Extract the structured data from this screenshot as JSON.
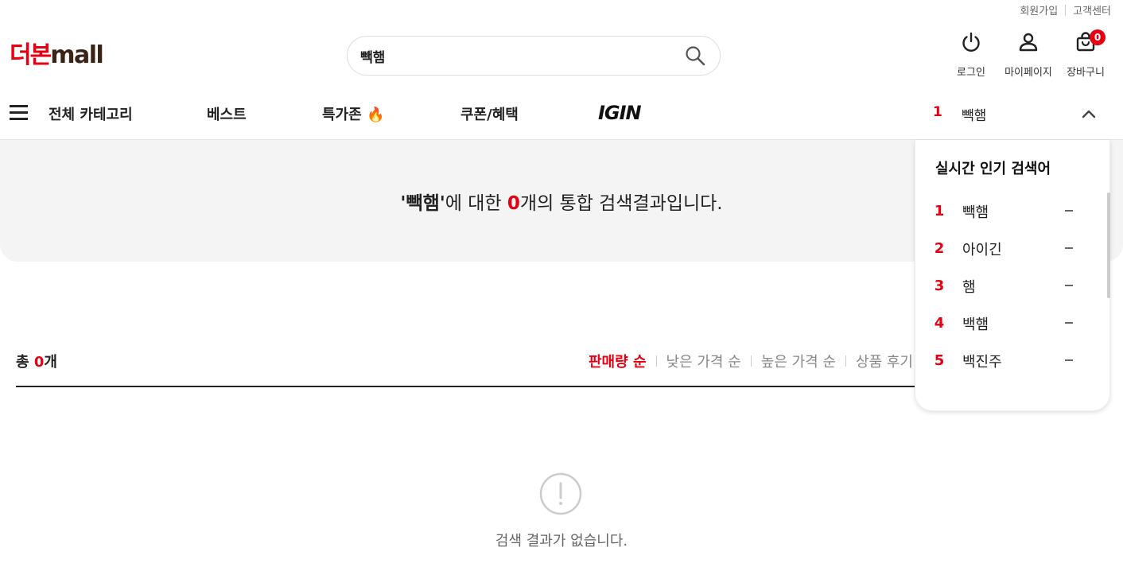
{
  "util": {
    "signup": "회원가입",
    "support": "고객센터"
  },
  "logo": {
    "ko": "더본",
    "en": "mall"
  },
  "search": {
    "value": "빽햄",
    "icon": "search-icon"
  },
  "header_icons": {
    "login": "로그인",
    "mypage": "마이페이지",
    "cart": "장바구니",
    "cart_count": "0"
  },
  "gnb": {
    "all_category": "전체 카테고리",
    "best": "베스트",
    "special": "특가존 🔥",
    "coupon": "쿠폰/혜택",
    "brand": "IGIN",
    "rolling_rank": "1",
    "rolling_word": "빽햄"
  },
  "result": {
    "q_open": "'",
    "keyword": "빽햄",
    "q_close": "'",
    "mid": "에 대한 ",
    "count": "0",
    "tail": "개의 통합 검색결과입니다."
  },
  "list_header": {
    "total_prefix": "총 ",
    "total_count": "0",
    "total_suffix": "개"
  },
  "sort": [
    "판매량 순",
    "낮은 가격 순",
    "높은 가격 순",
    "상품 후기 순"
  ],
  "empty": {
    "message": "검색 결과가 없습니다."
  },
  "popular": {
    "title": "실시간 인기 검색어",
    "items": [
      {
        "rank": "1",
        "word": "빽햄"
      },
      {
        "rank": "2",
        "word": "아이긴"
      },
      {
        "rank": "3",
        "word": "햄"
      },
      {
        "rank": "4",
        "word": "백햄"
      },
      {
        "rank": "5",
        "word": "백진주"
      }
    ]
  },
  "colors": {
    "accent": "#e60012",
    "brand_brown": "#3b2416"
  }
}
